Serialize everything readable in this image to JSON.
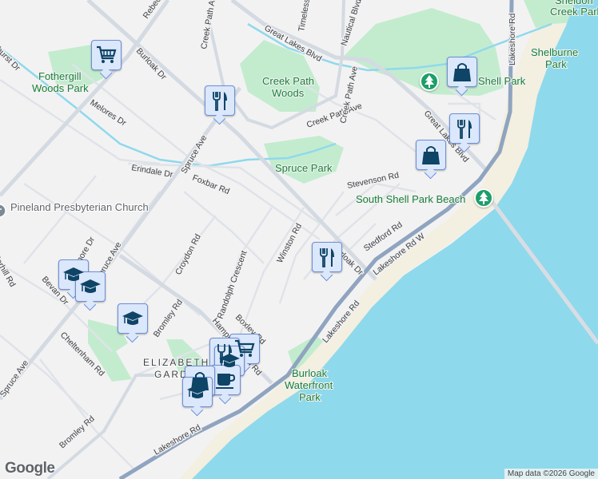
{
  "colors": {
    "water": "#8fd9ec",
    "park": "#c3eccf",
    "land": "#f3f2f3",
    "sand": "#f3efe1",
    "highway": "#8fa4bf",
    "road": "#d4dae2",
    "marker_fill": "#dbe7fb",
    "icon": "#0e4466",
    "park_pin": "#1e9e6a"
  },
  "streets": {
    "rebecca": "Rebecca St",
    "burloak_top": "Burloak Dr",
    "burloak_bottom": "Burloak Dr",
    "creek_path": "Creek Path Ave",
    "creek_path_2": "Creek Path Ave",
    "timeless": "Timeless Dr",
    "nautical": "Nautical Blvd",
    "great_lakes_top": "Great Lakes Blvd",
    "great_lakes_right": "Great Lakes Blvd",
    "lakeshore_n": "Lakeshore Rd",
    "lakeshore_w": "Lakeshore Rd W",
    "lakeshore_s": "Lakeshore Rd",
    "melores": "Melores Dr",
    "erindale": "Erindale Dr",
    "foxbar": "Foxbar Rd",
    "spruce_1": "Spruce Ave",
    "spruce_2": "Spruce Ave",
    "spruce_3": "Spruce Ave",
    "stevenson": "Stevenson Rd",
    "stedford": "Stedford Rd",
    "winston": "Winston Rd",
    "croydon": "Croydon Rd",
    "randolph": "Randolph Crescent",
    "boxley": "Boxley Rd",
    "hampton": "Hampton Heath Rd",
    "bromley_1": "Bromley Rd",
    "bromley_2": "Bromley Rd",
    "cheltenham": "Cheltenham Rd",
    "bevan": "Bevan Dr",
    "pinehurst": "Pinehurst Dr",
    "elmore": "Elmore Dr",
    "hill": "Underhill Rd"
  },
  "parks": {
    "fothergill_1": "Fothergill",
    "fothergill_2": "Woods Park",
    "creek_path_1": "Creek Path",
    "creek_path_2": "Woods",
    "spruce": "Spruce Park",
    "shell": "Shell Park",
    "shelburne_1": "Shelburne",
    "shelburne_2": "Park",
    "sheldon_1": "Sheldon",
    "sheldon_2": "Creek Park",
    "south_shell": "South Shell Park Beach",
    "burloak_1": "Burloak",
    "burloak_2": "Waterfront",
    "burloak_3": "Park"
  },
  "places": {
    "church": "Pineland Presbyterian Church",
    "neighbourhood_1": "ELIZABETH",
    "neighbourhood_2": "GARDENS"
  },
  "footer": {
    "google": "Google",
    "attribution": "Map data ©2026 Google"
  }
}
